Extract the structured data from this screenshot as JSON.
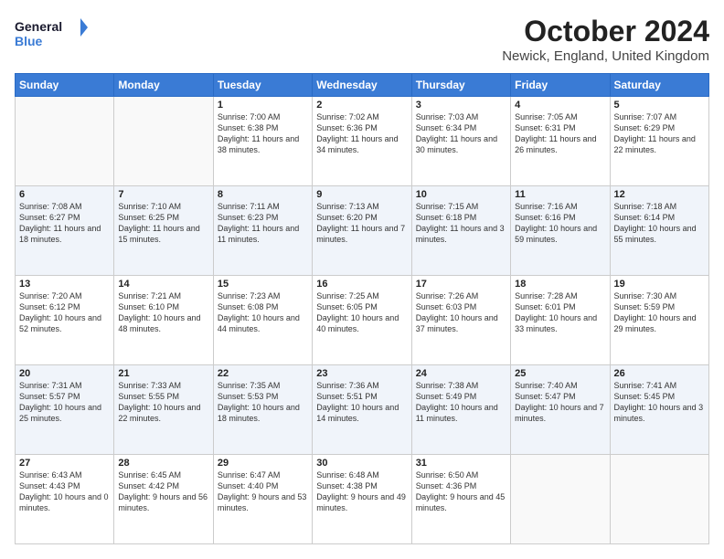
{
  "logo": {
    "line1": "General",
    "line2": "Blue"
  },
  "title": "October 2024",
  "location": "Newick, England, United Kingdom",
  "days_of_week": [
    "Sunday",
    "Monday",
    "Tuesday",
    "Wednesday",
    "Thursday",
    "Friday",
    "Saturday"
  ],
  "weeks": [
    [
      {
        "day": "",
        "info": ""
      },
      {
        "day": "",
        "info": ""
      },
      {
        "day": "1",
        "info": "Sunrise: 7:00 AM\nSunset: 6:38 PM\nDaylight: 11 hours and 38 minutes."
      },
      {
        "day": "2",
        "info": "Sunrise: 7:02 AM\nSunset: 6:36 PM\nDaylight: 11 hours and 34 minutes."
      },
      {
        "day": "3",
        "info": "Sunrise: 7:03 AM\nSunset: 6:34 PM\nDaylight: 11 hours and 30 minutes."
      },
      {
        "day": "4",
        "info": "Sunrise: 7:05 AM\nSunset: 6:31 PM\nDaylight: 11 hours and 26 minutes."
      },
      {
        "day": "5",
        "info": "Sunrise: 7:07 AM\nSunset: 6:29 PM\nDaylight: 11 hours and 22 minutes."
      }
    ],
    [
      {
        "day": "6",
        "info": "Sunrise: 7:08 AM\nSunset: 6:27 PM\nDaylight: 11 hours and 18 minutes."
      },
      {
        "day": "7",
        "info": "Sunrise: 7:10 AM\nSunset: 6:25 PM\nDaylight: 11 hours and 15 minutes."
      },
      {
        "day": "8",
        "info": "Sunrise: 7:11 AM\nSunset: 6:23 PM\nDaylight: 11 hours and 11 minutes."
      },
      {
        "day": "9",
        "info": "Sunrise: 7:13 AM\nSunset: 6:20 PM\nDaylight: 11 hours and 7 minutes."
      },
      {
        "day": "10",
        "info": "Sunrise: 7:15 AM\nSunset: 6:18 PM\nDaylight: 11 hours and 3 minutes."
      },
      {
        "day": "11",
        "info": "Sunrise: 7:16 AM\nSunset: 6:16 PM\nDaylight: 10 hours and 59 minutes."
      },
      {
        "day": "12",
        "info": "Sunrise: 7:18 AM\nSunset: 6:14 PM\nDaylight: 10 hours and 55 minutes."
      }
    ],
    [
      {
        "day": "13",
        "info": "Sunrise: 7:20 AM\nSunset: 6:12 PM\nDaylight: 10 hours and 52 minutes."
      },
      {
        "day": "14",
        "info": "Sunrise: 7:21 AM\nSunset: 6:10 PM\nDaylight: 10 hours and 48 minutes."
      },
      {
        "day": "15",
        "info": "Sunrise: 7:23 AM\nSunset: 6:08 PM\nDaylight: 10 hours and 44 minutes."
      },
      {
        "day": "16",
        "info": "Sunrise: 7:25 AM\nSunset: 6:05 PM\nDaylight: 10 hours and 40 minutes."
      },
      {
        "day": "17",
        "info": "Sunrise: 7:26 AM\nSunset: 6:03 PM\nDaylight: 10 hours and 37 minutes."
      },
      {
        "day": "18",
        "info": "Sunrise: 7:28 AM\nSunset: 6:01 PM\nDaylight: 10 hours and 33 minutes."
      },
      {
        "day": "19",
        "info": "Sunrise: 7:30 AM\nSunset: 5:59 PM\nDaylight: 10 hours and 29 minutes."
      }
    ],
    [
      {
        "day": "20",
        "info": "Sunrise: 7:31 AM\nSunset: 5:57 PM\nDaylight: 10 hours and 25 minutes."
      },
      {
        "day": "21",
        "info": "Sunrise: 7:33 AM\nSunset: 5:55 PM\nDaylight: 10 hours and 22 minutes."
      },
      {
        "day": "22",
        "info": "Sunrise: 7:35 AM\nSunset: 5:53 PM\nDaylight: 10 hours and 18 minutes."
      },
      {
        "day": "23",
        "info": "Sunrise: 7:36 AM\nSunset: 5:51 PM\nDaylight: 10 hours and 14 minutes."
      },
      {
        "day": "24",
        "info": "Sunrise: 7:38 AM\nSunset: 5:49 PM\nDaylight: 10 hours and 11 minutes."
      },
      {
        "day": "25",
        "info": "Sunrise: 7:40 AM\nSunset: 5:47 PM\nDaylight: 10 hours and 7 minutes."
      },
      {
        "day": "26",
        "info": "Sunrise: 7:41 AM\nSunset: 5:45 PM\nDaylight: 10 hours and 3 minutes."
      }
    ],
    [
      {
        "day": "27",
        "info": "Sunrise: 6:43 AM\nSunset: 4:43 PM\nDaylight: 10 hours and 0 minutes."
      },
      {
        "day": "28",
        "info": "Sunrise: 6:45 AM\nSunset: 4:42 PM\nDaylight: 9 hours and 56 minutes."
      },
      {
        "day": "29",
        "info": "Sunrise: 6:47 AM\nSunset: 4:40 PM\nDaylight: 9 hours and 53 minutes."
      },
      {
        "day": "30",
        "info": "Sunrise: 6:48 AM\nSunset: 4:38 PM\nDaylight: 9 hours and 49 minutes."
      },
      {
        "day": "31",
        "info": "Sunrise: 6:50 AM\nSunset: 4:36 PM\nDaylight: 9 hours and 45 minutes."
      },
      {
        "day": "",
        "info": ""
      },
      {
        "day": "",
        "info": ""
      }
    ]
  ]
}
